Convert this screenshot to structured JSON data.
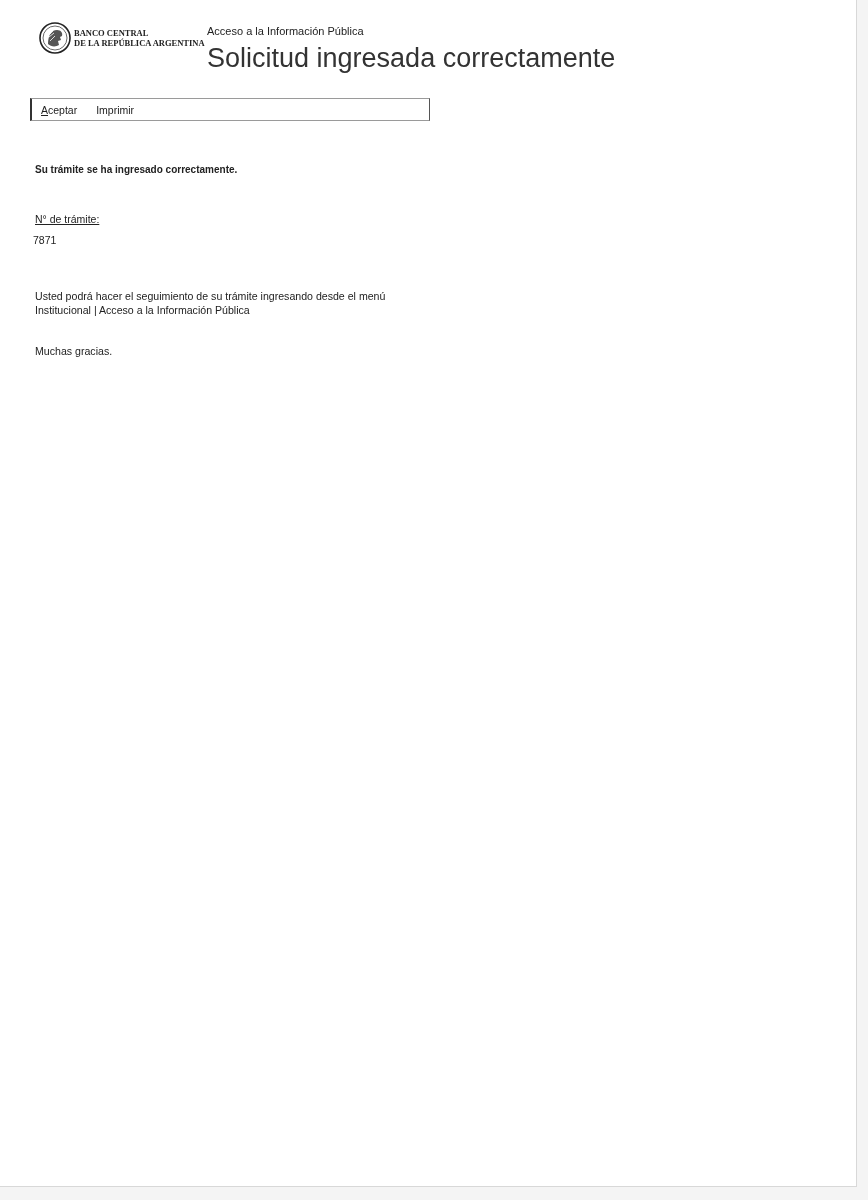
{
  "header": {
    "bank_name_lines": [
      "BANCO CENTRAL",
      "DE LA REPÚBLICA ARGENTINA"
    ],
    "section": "Acceso a la Información Pública",
    "title": "Solicitud ingresada correctamente"
  },
  "toolbar": {
    "buttons": [
      {
        "label": "Aceptar",
        "access_key_underlined": true
      },
      {
        "label": "Imprimir",
        "access_key_underlined": false
      }
    ]
  },
  "content": [
    {
      "kind": "notice",
      "text": "Su trámite se ha ingresado correctamente."
    },
    {
      "kind": "label",
      "text": "N° de trámite:"
    },
    {
      "kind": "value",
      "text": "7871"
    },
    {
      "kind": "paragraph",
      "lines": [
        "Usted podrá hacer el seguimiento de su trámite ingresando desde el menú",
        "Institucional | Acceso a la Información Pública"
      ]
    },
    {
      "kind": "closing",
      "text": "Muchas gracias."
    }
  ]
}
